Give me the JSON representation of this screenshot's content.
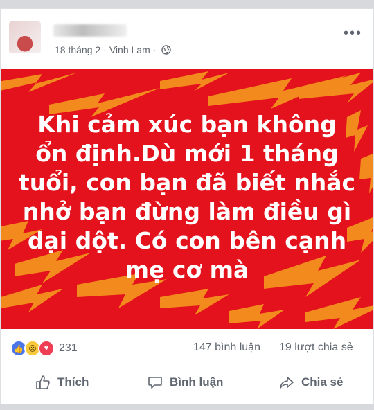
{
  "post": {
    "date": "18 tháng 2",
    "location": "Vinh Lam",
    "more_label": "•••"
  },
  "banner": {
    "lines": [
      "Khi cảm xúc bạn không",
      "ổn định.Dù mới 1 tháng",
      "tuổi, con bạn đã biết nhắc",
      "nhở bạn đừng làm điều gì",
      "dại dột. Có con bên cạnh",
      "mẹ cơ mà"
    ],
    "colors": {
      "background": "#e3121c",
      "bolts": "#f38a1d",
      "text": "#ffffff"
    }
  },
  "stats": {
    "reaction_count": "231",
    "reactions": [
      "like-icon",
      "sad-icon",
      "love-icon"
    ],
    "comments": "147 bình luận",
    "shares": "19 lượt chia sẻ"
  },
  "actions": {
    "like": "Thích",
    "comment": "Bình luận",
    "share": "Chia sẻ"
  }
}
